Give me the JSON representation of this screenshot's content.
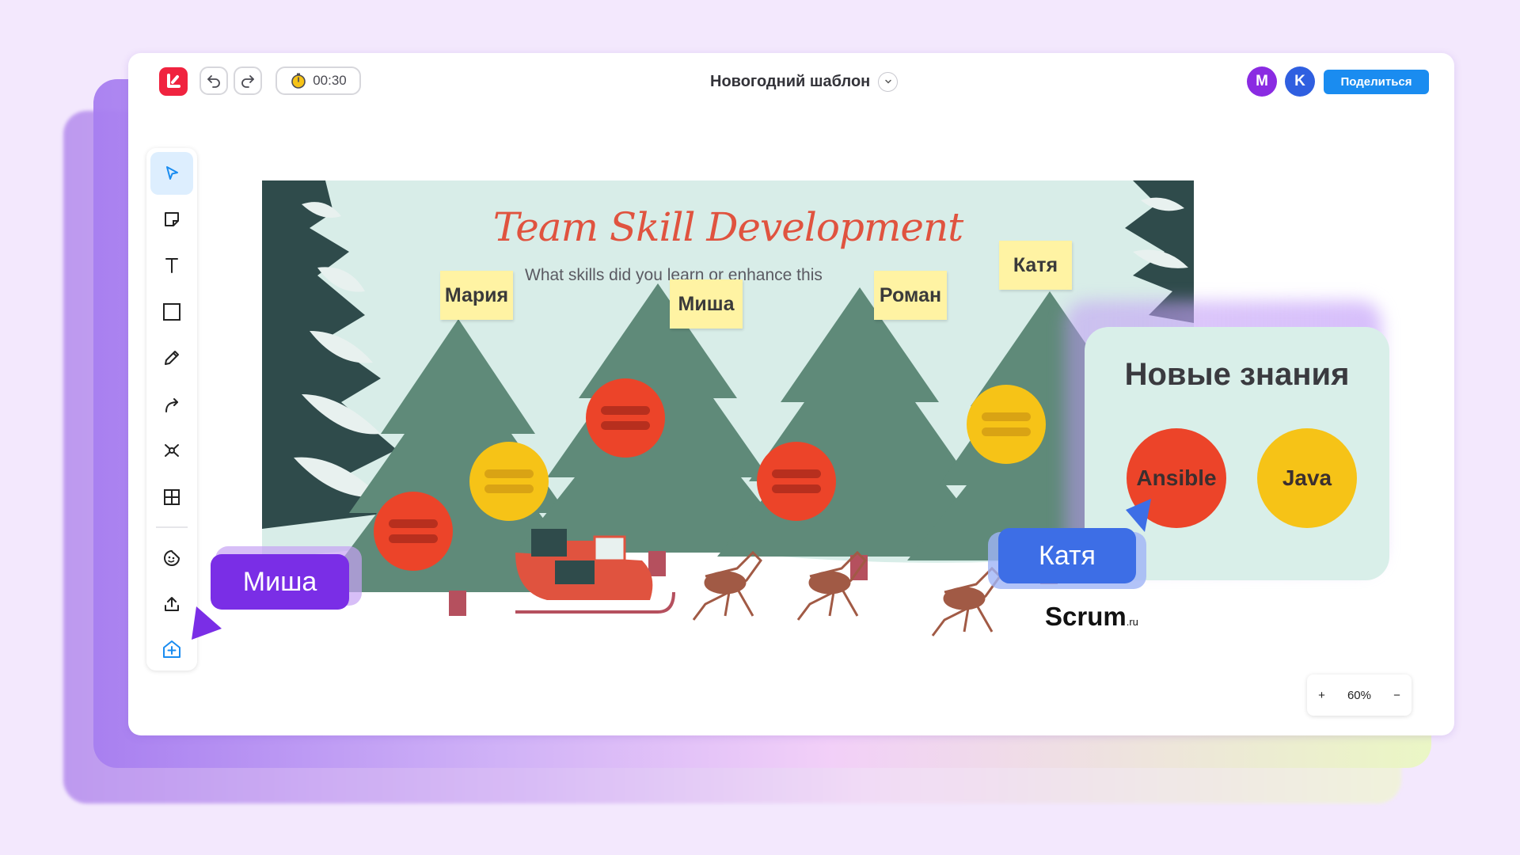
{
  "header": {
    "timer": "00:30",
    "doc_title": "Новогодний шаблон",
    "avatars": [
      {
        "letter": "M",
        "color": "#8a2be2"
      },
      {
        "letter": "K",
        "color": "#2f5fe0"
      }
    ],
    "share_label": "Поделиться"
  },
  "toolbar": {
    "tools": [
      "select-tool",
      "sticky-note-tool",
      "text-tool",
      "shape-tool",
      "pen-tool",
      "connector-tool",
      "mindmap-tool",
      "table-tool",
      "sticker-tool",
      "upload-tool",
      "template-tool"
    ]
  },
  "board": {
    "title": "Team Skill Development",
    "subtitle": "What skills did you learn or enhance this",
    "stickies": [
      "Мария",
      "Миша",
      "Роман",
      "Катя"
    ],
    "brand": "Scrum",
    "brand_suffix": ".ru"
  },
  "zoom": {
    "plus": "+",
    "level": "60%",
    "minus": "−"
  },
  "knowledge_card": {
    "title": "Новые знания",
    "items": [
      {
        "label": "Ansible",
        "color": "#ec4429"
      },
      {
        "label": "Java",
        "color": "#f6c317"
      }
    ]
  },
  "cursors": [
    {
      "name": "Миша",
      "color": "#7a2ee6"
    },
    {
      "name": "Катя",
      "color": "#3d6ee6"
    }
  ],
  "colors": {
    "brand_red": "#f0233f",
    "share_blue": "#1a8cf0",
    "board_bg": "#d8ede8",
    "tree_green": "#5f8a79"
  }
}
